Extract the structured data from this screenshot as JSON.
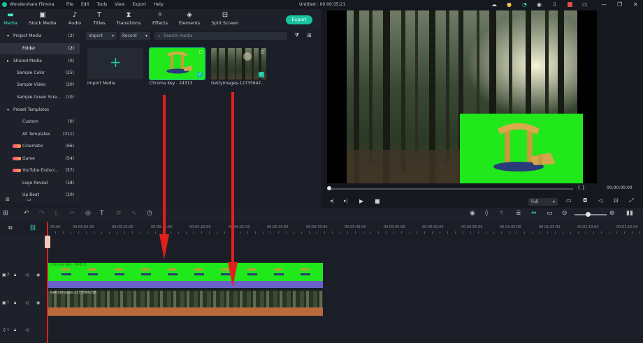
{
  "app": {
    "name": "Wondershare Filmora",
    "menu": [
      "File",
      "Edit",
      "Tools",
      "View",
      "Export",
      "Help"
    ],
    "project_title": "Untitled : 00:00:35:21"
  },
  "toolbar": {
    "tabs": [
      {
        "label": "Media",
        "icon": "folder-icon",
        "active": true
      },
      {
        "label": "Stock Media",
        "icon": "film-icon",
        "active": false
      },
      {
        "label": "Audio",
        "icon": "music-icon",
        "active": false
      },
      {
        "label": "Titles",
        "icon": "text-icon",
        "active": false
      },
      {
        "label": "Transitions",
        "icon": "transition-icon",
        "active": false
      },
      {
        "label": "Effects",
        "icon": "effects-icon",
        "active": false
      },
      {
        "label": "Elements",
        "icon": "elements-icon",
        "active": false
      },
      {
        "label": "Split Screen",
        "icon": "split-screen-icon",
        "active": false
      }
    ],
    "export_label": "Export",
    "accent": "#17c3a0"
  },
  "sidebar": {
    "items": [
      {
        "label": "Project Media",
        "count": "(2)",
        "expand": "▾"
      },
      {
        "label": "Folder",
        "count": "(2)",
        "selected": true
      },
      {
        "label": "Shared Media",
        "count": "(0)",
        "expand": "▸"
      },
      {
        "label": "Sample Color",
        "count": "(25)"
      },
      {
        "label": "Sample Video",
        "count": "(20)"
      },
      {
        "label": "Sample Green Scre...",
        "count": "(10)"
      },
      {
        "label": "Preset Templates",
        "count": "",
        "expand": "▾"
      },
      {
        "label": "Custom",
        "count": "(0)"
      },
      {
        "label": "All Templates",
        "count": "(311)"
      },
      {
        "label": "Cinematic",
        "count": "(66)",
        "tag": true
      },
      {
        "label": "Game",
        "count": "(54)",
        "tag": true
      },
      {
        "label": "YouTube Endscr...",
        "count": "(57)",
        "tag": true
      },
      {
        "label": "Logo Reveal",
        "count": "(18)"
      },
      {
        "label": "Up Beat",
        "count": "(10)"
      }
    ]
  },
  "media": {
    "import_label": "Import",
    "record_label": "Record",
    "search_placeholder": "Search media",
    "items": [
      {
        "label": "Import Media",
        "type": "import"
      },
      {
        "label": "Chroma Key - 24313",
        "type": "green"
      },
      {
        "label": "GettyImages-12735842...",
        "type": "forest"
      }
    ]
  },
  "preview": {
    "timecode": "00:00:00:00",
    "quality": "Full",
    "brackets": "{   }"
  },
  "timeline": {
    "ruler_ticks": [
      "00:00",
      "00:00:05:00",
      "00:00:10:00",
      "00:00:15:00",
      "00:00:20:00",
      "00:00:25:00",
      "00:00:30:00",
      "00:00:35:00",
      "00:00:40:00",
      "00:00:45:00",
      "00:00:50:00",
      "00:00:55:00",
      "00:01:00:00",
      "00:01:05:00",
      "00:01:10:00",
      "00:01:15:00"
    ],
    "clips": [
      {
        "label": "Chroma Key - 24313",
        "track": "2"
      },
      {
        "label": "GettyImages-1273584238",
        "track": "1"
      }
    ],
    "track_labels": [
      "2",
      "1",
      "1"
    ]
  }
}
